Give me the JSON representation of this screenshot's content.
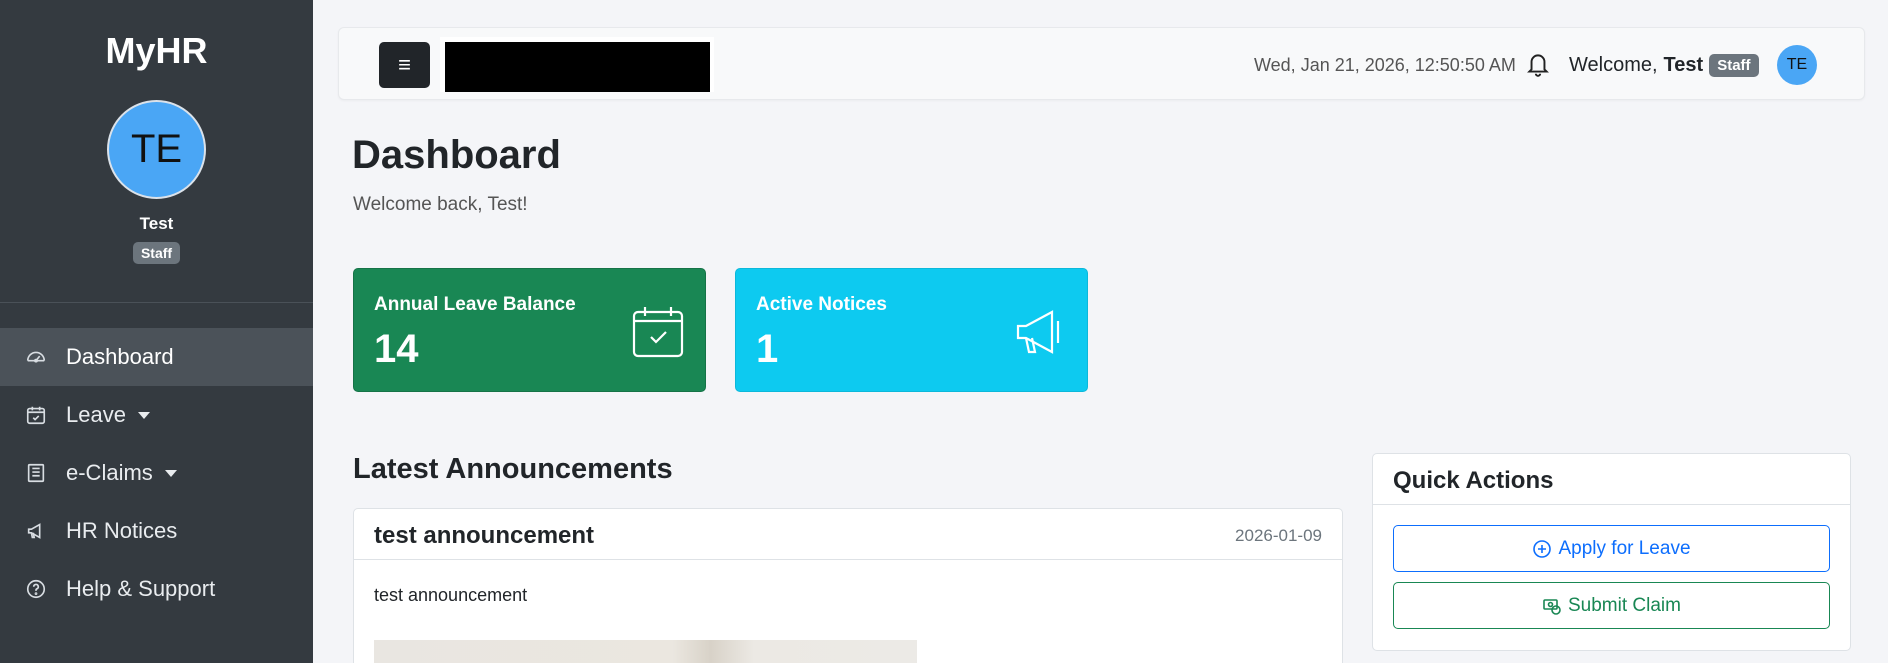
{
  "sidebar": {
    "brand": "MyHR",
    "avatar_initials": "TE",
    "user_name": "Test",
    "role_badge": "Staff",
    "items": [
      {
        "label": "Dashboard",
        "icon": "speedometer-icon",
        "active": true
      },
      {
        "label": "Leave",
        "icon": "calendar-check-icon",
        "dropdown": true
      },
      {
        "label": "e-Claims",
        "icon": "receipt-icon",
        "dropdown": true
      },
      {
        "label": "HR Notices",
        "icon": "megaphone-icon"
      },
      {
        "label": "Help & Support",
        "icon": "question-circle-icon"
      }
    ]
  },
  "topbar": {
    "menu_icon": "≡",
    "datetime": "Wed, Jan 21, 2026, 12:50:50 AM",
    "welcome_prefix": "Welcome,",
    "user_name": "Test",
    "role_badge": "Staff",
    "avatar_initials": "TE"
  },
  "main": {
    "title": "Dashboard",
    "subtitle": "Welcome back, Test!",
    "stats": [
      {
        "label": "Annual Leave Balance",
        "value": "14",
        "icon": "calendar-check-icon",
        "color": "#198754"
      },
      {
        "label": "Active Notices",
        "value": "1",
        "icon": "megaphone-icon",
        "color": "#0dcaf0"
      }
    ],
    "announcements": {
      "section_title": "Latest Announcements",
      "items": [
        {
          "title": "test announcement",
          "date": "2026-01-09",
          "body": "test announcement"
        }
      ]
    },
    "quick_actions": {
      "title": "Quick Actions",
      "apply_leave": "Apply for Leave",
      "submit_claim": "Submit Claim"
    }
  }
}
